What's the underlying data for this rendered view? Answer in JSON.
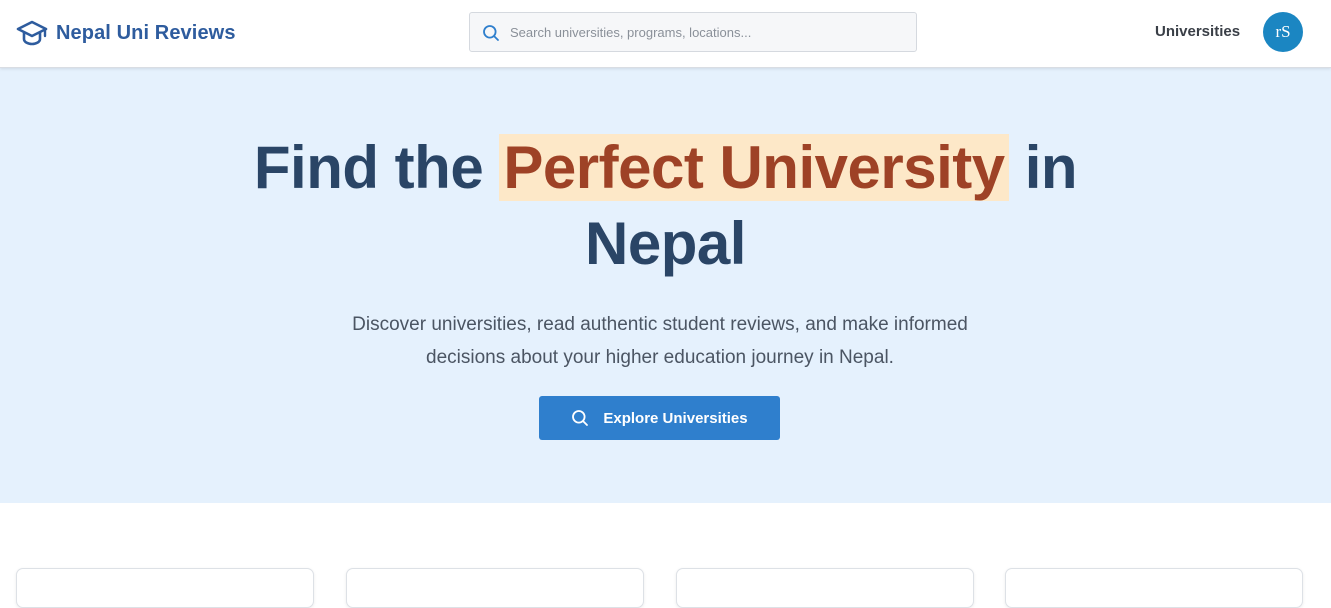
{
  "header": {
    "brand": "Nepal Uni Reviews",
    "brand_icon": "graduation-cap-icon",
    "search": {
      "placeholder": "Search universities, programs, locations...",
      "value": "",
      "icon": "search-icon"
    },
    "nav_universities": "Universities",
    "avatar_initials": "rS"
  },
  "hero": {
    "title_before": "Find the",
    "title_highlight": "Perfect University",
    "title_after": "in",
    "title_line2": "Nepal",
    "subtitle": "Discover universities, read authentic student reviews, and make informed decisions about your higher education journey in Nepal.",
    "cta_label": "Explore Universities",
    "cta_icon": "search-icon"
  },
  "colors": {
    "brand": "#2e5c9e",
    "hero_bg": "#e5f1fd",
    "title": "#2a4566",
    "highlight_bg": "#fde8c8",
    "highlight_text": "#9e4226",
    "cta_bg": "#2f7fcd",
    "avatar_bg": "#1b86c2"
  }
}
